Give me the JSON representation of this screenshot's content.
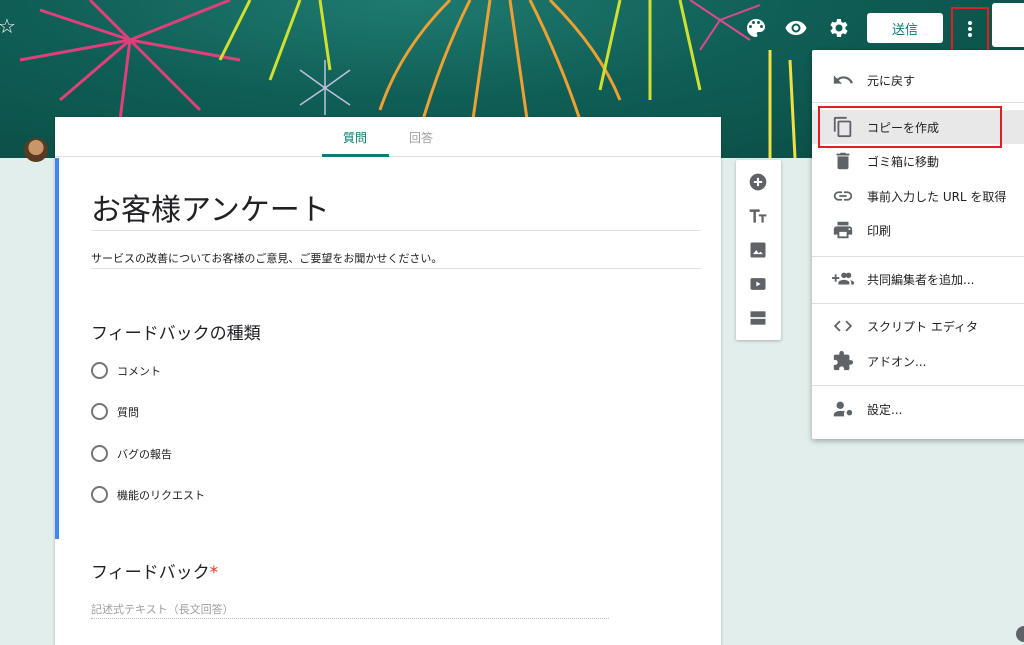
{
  "header": {
    "send_label": "送信"
  },
  "tabs": {
    "questions_label": "質問",
    "responses_label": "回答"
  },
  "form": {
    "title": "お客様アンケート",
    "description": "サービスの改善についてお客様のご意見、ご要望をお聞かせください。",
    "questions": [
      {
        "title": "フィードバックの種類",
        "options": [
          "コメント",
          "質問",
          "バグの報告",
          "機能のリクエスト"
        ]
      },
      {
        "title": "フィードバック",
        "required_mark": "*",
        "answer_placeholder": "記述式テキスト（長文回答）"
      }
    ]
  },
  "menu": {
    "items": [
      {
        "label": "元に戻す",
        "icon": "undo-icon"
      },
      {
        "label": "コピーを作成",
        "icon": "copy-icon"
      },
      {
        "label": "ゴミ箱に移動",
        "icon": "trash-icon"
      },
      {
        "label": "事前入力した URL を取得",
        "icon": "link-icon"
      },
      {
        "label": "印刷",
        "icon": "print-icon"
      },
      {
        "label": "共同編集者を追加...",
        "icon": "add-person-icon"
      },
      {
        "label": "スクリプト エディタ",
        "icon": "code-icon"
      },
      {
        "label": "アドオン...",
        "icon": "puzzle-icon"
      },
      {
        "label": "設定...",
        "icon": "person-settings-icon"
      }
    ]
  },
  "colors": {
    "accent": "#0b7d72",
    "highlight_border": "#e02020",
    "active_section": "#4285f4"
  }
}
